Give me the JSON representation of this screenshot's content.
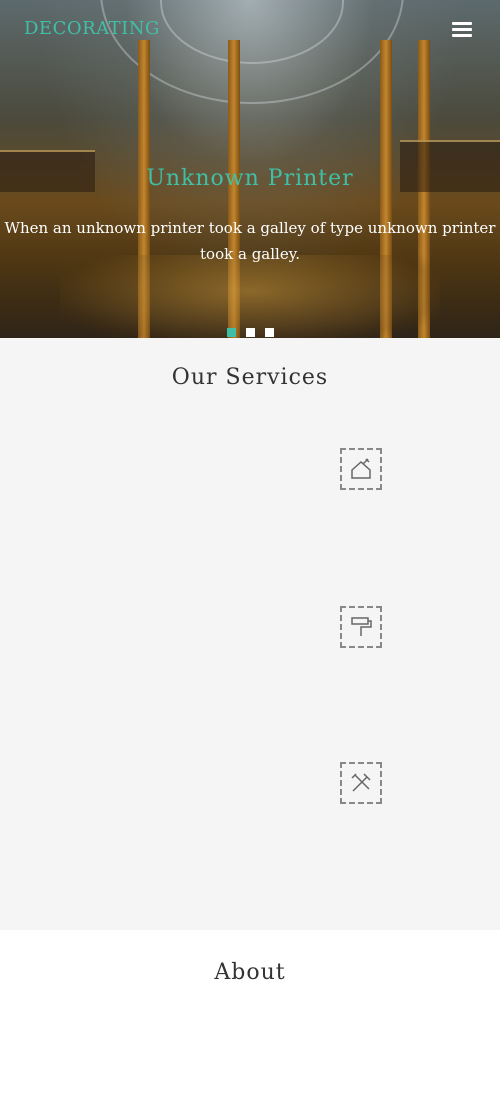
{
  "header": {
    "logo": "DECORATING",
    "menu_icon": "hamburger-menu-icon"
  },
  "hero": {
    "title": "Unknown Printer",
    "text": "When an unknown printer took a galley of type unknown printer took a galley.",
    "slides": 3,
    "active_slide": 1
  },
  "services": {
    "title": "Our Services",
    "icons": [
      "wrench-house-icon",
      "paint-roller-icon",
      "screwdriver-wrench-icon"
    ]
  },
  "about": {
    "title": "About"
  },
  "colors": {
    "accent": "#3fc0a6",
    "text": "#333333",
    "background": "#f5f5f5"
  }
}
